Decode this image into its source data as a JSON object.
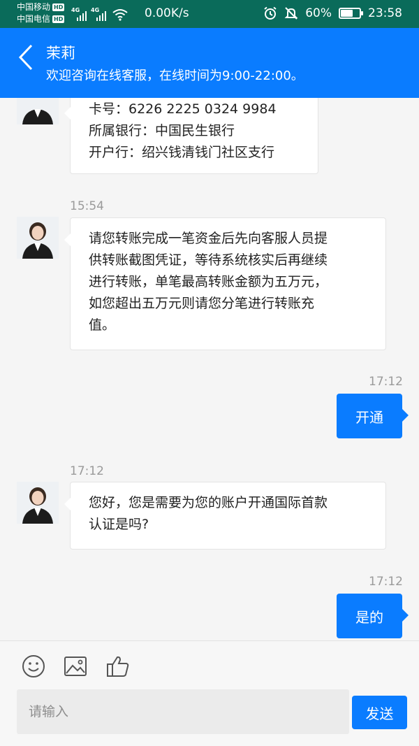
{
  "status_bar": {
    "carrier1": "中国移动",
    "carrier2": "中国电信",
    "hd_badge": "HD",
    "net1": "4G",
    "net2": "4G",
    "speed": "0.00K/s",
    "battery": "60%",
    "battery_level": 0.6,
    "time": "23:58"
  },
  "header": {
    "title": "茉莉",
    "subtitle": "欢迎咨询在线客服，在线时间为9:00-22:00。"
  },
  "messages": [
    {
      "lines": [
        "卡号：6226 2225 0324 9984",
        "所属银行：中国民生银行",
        "开户行：绍兴钱清钱门社区支行"
      ]
    },
    {
      "time": "15:54",
      "lines": [
        "请您转账完成一笔资金后先向客服人员提",
        "供转账截图凭证，等待系统核实后再继续",
        "进行转账，单笔最高转账金额为五万元，",
        "如您超出五万元则请您分笔进行转账充",
        "值。"
      ]
    },
    {
      "time": "17:12",
      "text": "开通"
    },
    {
      "time": "17:12",
      "lines": [
        "您好，您是需要为您的账户开通国际首款",
        "认证是吗?"
      ]
    },
    {
      "time": "17:12",
      "text": "是的"
    }
  ],
  "composer": {
    "placeholder": "请输入",
    "send_label": "发送"
  },
  "colors": {
    "accent": "#0a7cff",
    "status_bar": "#0a6b5a"
  }
}
